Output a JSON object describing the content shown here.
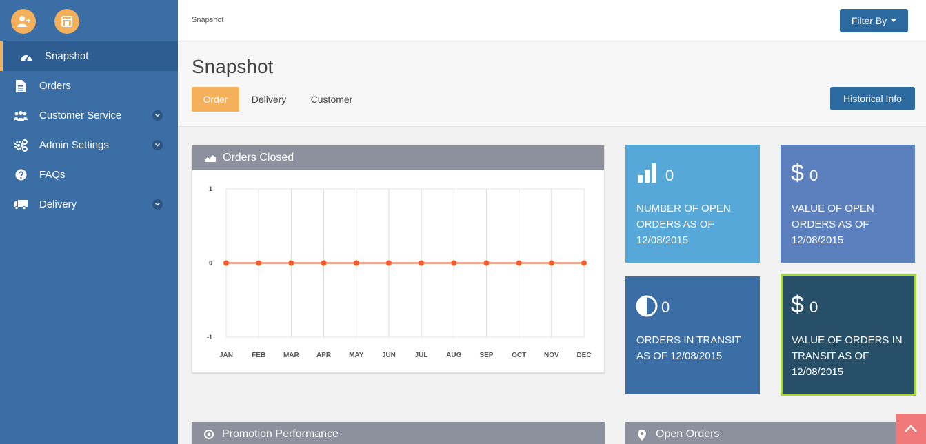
{
  "sidebar": {
    "items": [
      {
        "label": "Snapshot",
        "icon": "dashboard-icon"
      },
      {
        "label": "Orders",
        "icon": "document-icon"
      },
      {
        "label": "Customer Service",
        "icon": "users-icon"
      },
      {
        "label": "Admin Settings",
        "icon": "gears-icon"
      },
      {
        "label": "FAQs",
        "icon": "question-icon"
      },
      {
        "label": "Delivery",
        "icon": "truck-icon"
      }
    ]
  },
  "topbar": {
    "breadcrumb": "Snapshot",
    "filter_label": "Filter By"
  },
  "header": {
    "title": "Snapshot",
    "tabs": [
      {
        "label": "Order"
      },
      {
        "label": "Delivery"
      },
      {
        "label": "Customer"
      }
    ],
    "historical_label": "Historical Info"
  },
  "orders_closed": {
    "title": "Orders Closed"
  },
  "chart_data": {
    "type": "line",
    "categories": [
      "JAN",
      "FEB",
      "MAR",
      "APR",
      "MAY",
      "JUN",
      "JUL",
      "AUG",
      "SEP",
      "OCT",
      "NOV",
      "DEC"
    ],
    "values": [
      0,
      0,
      0,
      0,
      0,
      0,
      0,
      0,
      0,
      0,
      0,
      0
    ],
    "yticks": [
      "1",
      "0",
      "-1"
    ],
    "ylim": [
      -1,
      1
    ],
    "title": "Orders Closed",
    "xlabel": "",
    "ylabel": "",
    "grid": true,
    "line_color": "#f15a29"
  },
  "tiles": [
    {
      "value": "0",
      "label": "NUMBER OF OPEN ORDERS AS OF 12/08/2015",
      "color": "#56a8d8"
    },
    {
      "value": "0",
      "label": "VALUE OF OPEN ORDERS AS OF 12/08/2015",
      "color": "#5b80bd"
    },
    {
      "value": "0",
      "label": "ORDERS IN TRANSIT AS OF 12/08/2015",
      "color": "#3a6ea5"
    },
    {
      "value": "0",
      "label": "VALUE OF ORDERS IN TRANSIT AS OF 12/08/2015",
      "color": "#284f68",
      "border": "#a5d63a"
    }
  ],
  "tile_symbols": {
    "dollar": "$"
  },
  "bottom_panels": {
    "promotion": "Promotion Performance",
    "open_orders": "Open Orders"
  }
}
